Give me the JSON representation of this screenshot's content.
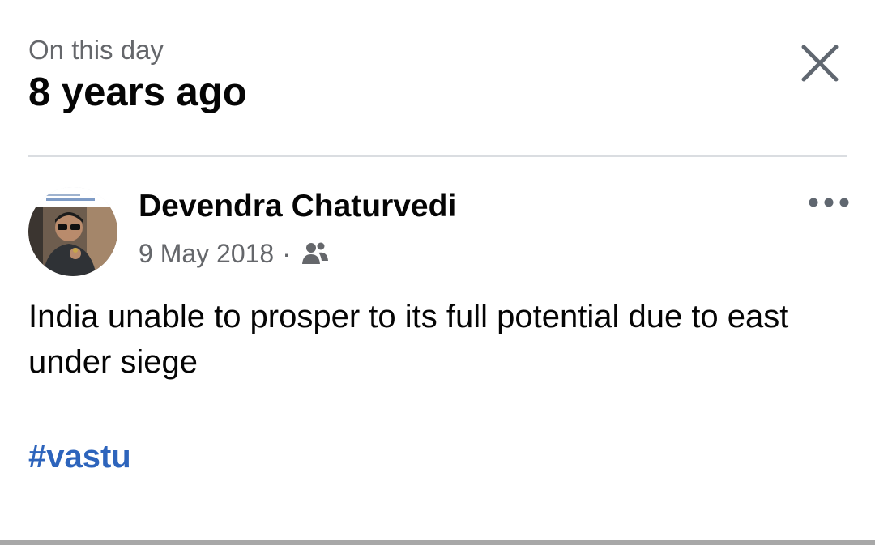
{
  "memory": {
    "kicker": "On this day",
    "headline": "8 years ago",
    "close_icon": "close-icon"
  },
  "post": {
    "author": "Devendra Chaturvedi",
    "date": "9 May 2018",
    "separator": "·",
    "audience_icon": "friends-icon",
    "more_icon": "more-horizontal-icon",
    "text": "India unable to prosper to its full potential due to east under siege",
    "hashtag": "#vastu"
  },
  "colors": {
    "secondary_text": "#65676b",
    "primary_text": "#050505",
    "link": "#2d64bc",
    "divider": "#dadde1"
  }
}
